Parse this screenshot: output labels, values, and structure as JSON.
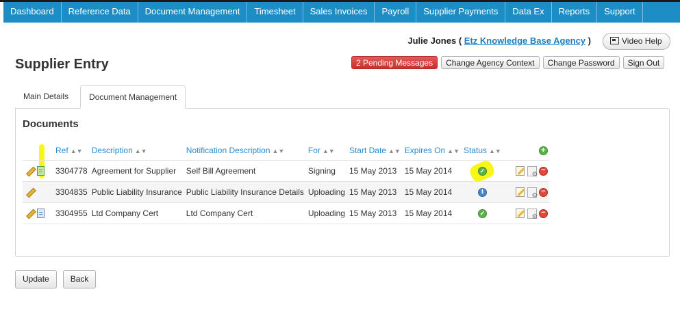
{
  "nav": {
    "items": [
      "Dashboard",
      "Reference Data",
      "Document Management",
      "Timesheet",
      "Sales Invoices",
      "Payroll",
      "Supplier Payments",
      "Data Ex",
      "Reports",
      "Support"
    ]
  },
  "user": {
    "name": "Julie Jones",
    "open_paren": "(",
    "agency": "Etz Knowledge Base Agency",
    "close_paren": ")"
  },
  "video_help": "Video Help",
  "page_title": "Supplier Entry",
  "actions": {
    "pending": "2 Pending Messages",
    "change_agency": "Change Agency Context",
    "change_password": "Change Password",
    "sign_out": "Sign Out"
  },
  "tabs": [
    "Main Details",
    "Document Management"
  ],
  "documents": {
    "title": "Documents",
    "columns": [
      "Ref",
      "Description",
      "Notification Description",
      "For",
      "Start Date",
      "Expires On",
      "Status"
    ],
    "rows": [
      {
        "ref": "3304778",
        "description": "Agreement for Supplier",
        "notification": "Self Bill Agreement",
        "for": "Signing",
        "start": "15 May 2013",
        "expires": "15 May 2014",
        "status": "ok"
      },
      {
        "ref": "3304835",
        "description": "Public Liability Insurance",
        "notification": "Public Liability Insurance Details",
        "for": "Uploading",
        "start": "15 May 2013",
        "expires": "15 May 2014",
        "status": "info"
      },
      {
        "ref": "3304955",
        "description": "Ltd Company Cert",
        "notification": "Ltd Company Cert",
        "for": "Uploading",
        "start": "15 May 2013",
        "expires": "15 May 2014",
        "status": "ok"
      }
    ]
  },
  "icons": {
    "ok": "✓",
    "info": "i",
    "delete": "−",
    "add": "+"
  },
  "buttons": {
    "update": "Update",
    "back": "Back"
  },
  "colors": {
    "nav": "#1d8ec5",
    "pending": "#c9302c",
    "link": "#2a8ad0",
    "highlight": "#f5f500"
  }
}
